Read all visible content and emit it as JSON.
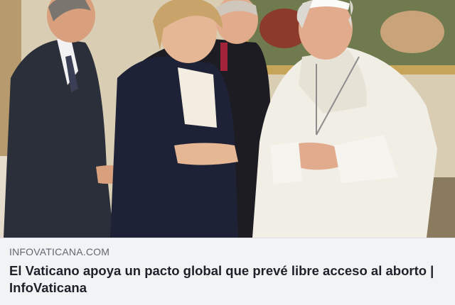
{
  "link_preview": {
    "domain": "INFOVATICANA.COM",
    "headline": "El Vaticano apoya un pacto global que prevé libre acceso al aborto | InfoVaticana",
    "image_icon": "photo",
    "colors": {
      "card_background": "#f2f3f5",
      "domain_text": "#606770",
      "headline_text": "#1d2129"
    }
  }
}
